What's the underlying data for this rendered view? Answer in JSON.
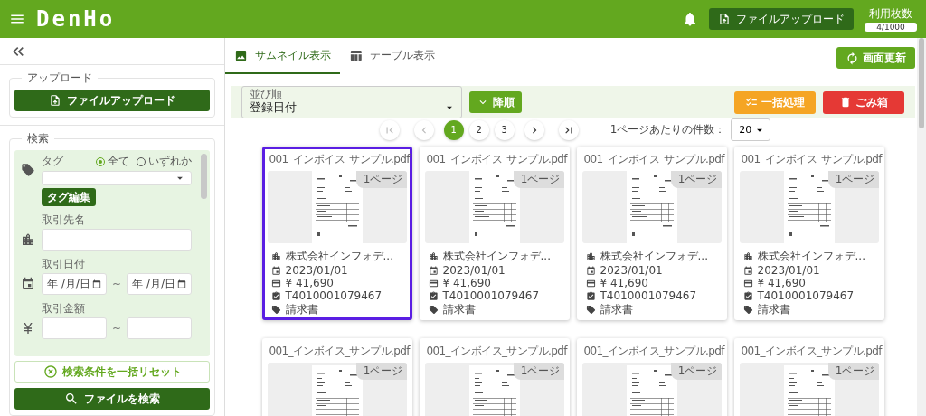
{
  "header": {
    "logo": "DenHo",
    "upload_button": "ファイルアップロード",
    "usage_label": "利用枚数",
    "usage_value": "4/1000"
  },
  "sidebar": {
    "upload_section": {
      "legend": "アップロード",
      "button": "ファイルアップロード"
    },
    "search_section": {
      "legend": "検索",
      "tag_label": "タグ",
      "tag_modes": [
        {
          "label": "全て",
          "selected": true
        },
        {
          "label": "いずれか",
          "selected": false
        }
      ],
      "tag_edit_button": "タグ編集",
      "partner_label": "取引先名",
      "date_label": "取引日付",
      "date_from": "年 /月/日",
      "date_to": "年 /月/日",
      "range_sep_date": "~",
      "amount_label": "取引金額",
      "range_sep_amount": "~",
      "reset_button": "検索条件を一括リセット",
      "search_button": "ファイルを検索"
    }
  },
  "tabs": [
    {
      "label": "サムネイル表示",
      "selected": true
    },
    {
      "label": "テーブル表示",
      "selected": false
    }
  ],
  "refresh_button": "画面更新",
  "toolbar": {
    "sort_label": "並び順",
    "sort_value": "登録日付",
    "order_button": "降順",
    "bulk_button": "一括処理",
    "trash_button": "ごみ箱"
  },
  "pagination": {
    "pages": [
      {
        "label": "1",
        "selected": true
      },
      {
        "label": "2",
        "selected": false
      },
      {
        "label": "3",
        "selected": false
      }
    ],
    "per_page_label": "1ページあたりの件数：",
    "per_page_value": "20"
  },
  "cards": [
    {
      "filename": "001_インボイス_サンプル.pdf",
      "pages": "1ページ",
      "selected": true,
      "company": "株式会社インフォデ...",
      "date": "2023/01/01",
      "amount": "¥ 41,690",
      "registration": "T4010001079467",
      "tag": "請求書"
    },
    {
      "filename": "001_インボイス_サンプル.pdf",
      "pages": "1ページ",
      "selected": false,
      "company": "株式会社インフォデ...",
      "date": "2023/01/01",
      "amount": "¥ 41,690",
      "registration": "T4010001079467",
      "tag": "請求書"
    },
    {
      "filename": "001_インボイス_サンプル.pdf",
      "pages": "1ページ",
      "selected": false,
      "company": "株式会社インフォデ...",
      "date": "2023/01/01",
      "amount": "¥ 41,690",
      "registration": "T4010001079467",
      "tag": "請求書"
    },
    {
      "filename": "001_インボイス_サンプル.pdf",
      "pages": "1ページ",
      "selected": false,
      "company": "株式会社インフォデ...",
      "date": "2023/01/01",
      "amount": "¥ 41,690",
      "registration": "T4010001079467",
      "tag": "請求書"
    },
    {
      "filename": "001_インボイス_サンプル.pdf",
      "pages": "1ページ",
      "selected": false
    },
    {
      "filename": "001_インボイス_サンプル.pdf",
      "pages": "1ページ",
      "selected": false
    },
    {
      "filename": "001_インボイス_サンプル.pdf",
      "pages": "1ページ",
      "selected": false
    },
    {
      "filename": "001_インボイス_サンプル.pdf",
      "pages": "1ページ",
      "selected": false
    }
  ]
}
